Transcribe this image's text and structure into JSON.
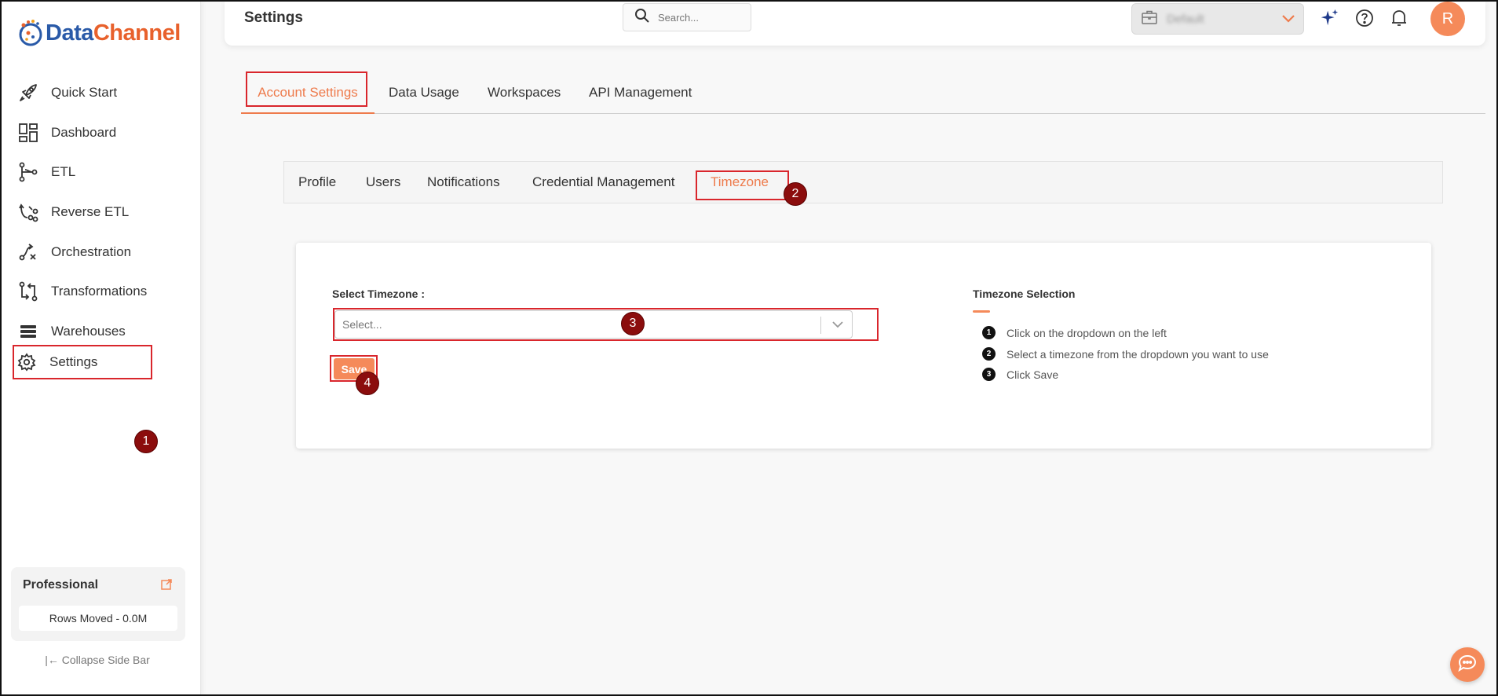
{
  "brand": {
    "name_part1": "Data",
    "name_part2": "Channel"
  },
  "sidebar": {
    "items": [
      {
        "label": "Quick Start",
        "icon": "rocket-icon"
      },
      {
        "label": "Dashboard",
        "icon": "dashboard-icon"
      },
      {
        "label": "ETL",
        "icon": "etl-icon"
      },
      {
        "label": "Reverse ETL",
        "icon": "reverse-etl-icon"
      },
      {
        "label": "Orchestration",
        "icon": "orchestration-icon"
      },
      {
        "label": "Transformations",
        "icon": "transformations-icon"
      },
      {
        "label": "Warehouses",
        "icon": "warehouses-icon"
      },
      {
        "label": "Settings",
        "icon": "gear-icon"
      }
    ],
    "plan": {
      "title": "Professional",
      "rows": "Rows Moved - 0.0M"
    },
    "collapse_label": "Collapse Side Bar",
    "collapse_icon": "|←"
  },
  "header": {
    "title": "Settings",
    "search_placeholder": "Search...",
    "workspace": "Default",
    "avatar_initial": "R"
  },
  "tabs": [
    "Account Settings",
    "Data Usage",
    "Workspaces",
    "API Management"
  ],
  "subtabs": [
    "Profile",
    "Users",
    "Notifications",
    "Credential Management",
    "Timezone"
  ],
  "form": {
    "label": "Select Timezone :",
    "placeholder": "Select...",
    "save_label": "Save"
  },
  "help": {
    "title": "Timezone Selection",
    "steps": [
      {
        "num": "1",
        "text": "Click on the dropdown on the left"
      },
      {
        "num": "2",
        "text": "Select a timezone from the dropdown you want to use"
      },
      {
        "num": "3",
        "text": "Click Save"
      }
    ]
  },
  "annotations": [
    "1",
    "2",
    "3",
    "4"
  ],
  "colors": {
    "accent": "#ee7b4c",
    "avatar": "#f58a5a",
    "highlight": "#d9262c",
    "badge": "#8b0d0d"
  }
}
